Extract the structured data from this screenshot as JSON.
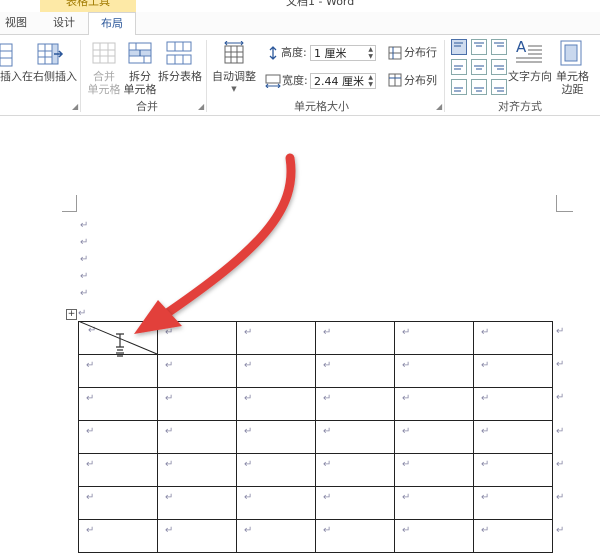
{
  "window": {
    "context_tab_group": "表格工具",
    "doc_title": "文档1 - Word"
  },
  "tabs": [
    {
      "label": "视图"
    },
    {
      "label": "设计"
    },
    {
      "label": "布局"
    }
  ],
  "ribbon": {
    "rows_cols": {
      "insert_left_partial": "插入",
      "insert_right": "在右侧插入"
    },
    "merge": {
      "merge_cells_line1": "合并",
      "merge_cells_line2": "单元格",
      "split_cells_line1": "拆分",
      "split_cells_line2": "单元格",
      "split_table": "拆分表格",
      "group_label": "合并"
    },
    "cell_size": {
      "autofit": "自动调整",
      "height_label": "高度:",
      "height_value": "1 厘米",
      "width_label": "宽度:",
      "width_value": "2.44 厘米",
      "distribute_rows": "分布行",
      "distribute_cols": "分布列",
      "group_label": "单元格大小"
    },
    "alignment": {
      "text_direction": "文字方向",
      "cell_margins_line1": "单元格",
      "cell_margins_line2": "边距",
      "group_label": "对齐方式"
    }
  },
  "document": {
    "paragraph_mark": "↵",
    "table": {
      "rows": 7,
      "cols": 6
    }
  },
  "colors": {
    "accent": "#2b579a",
    "arrow": "#e2403a",
    "context_tab": "#fde9a6"
  }
}
